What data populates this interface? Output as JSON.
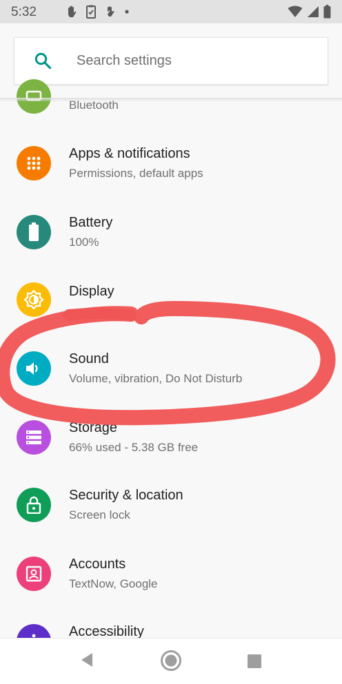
{
  "status_bar": {
    "time": "5:32",
    "left_icons": [
      "hand-icon",
      "clipboard-icon",
      "gesture-icon",
      "dot-icon"
    ],
    "right_icons": [
      "wifi-icon",
      "signal-icon",
      "battery-icon"
    ]
  },
  "search": {
    "placeholder": "Search settings",
    "accent": "#009688"
  },
  "settings_items": [
    {
      "id": "bluetooth",
      "title": "",
      "subtitle": "Bluetooth",
      "icon": "devices-icon",
      "color": "#7cb342"
    },
    {
      "id": "apps",
      "title": "Apps & notifications",
      "subtitle": "Permissions, default apps",
      "icon": "apps-grid-icon",
      "color": "#f57c00"
    },
    {
      "id": "battery",
      "title": "Battery",
      "subtitle": "100%",
      "icon": "battery-icon",
      "color": "#26897b"
    },
    {
      "id": "display",
      "title": "Display",
      "subtitle": "",
      "icon": "brightness-icon",
      "color": "#fbbc05"
    },
    {
      "id": "sound",
      "title": "Sound",
      "subtitle": "Volume, vibration, Do Not Disturb",
      "icon": "volume-icon",
      "color": "#00acc1"
    },
    {
      "id": "storage",
      "title": "Storage",
      "subtitle": "66% used - 5.38 GB free",
      "icon": "storage-icon",
      "color": "#b94fdf"
    },
    {
      "id": "security",
      "title": "Security & location",
      "subtitle": "Screen lock",
      "icon": "lock-icon",
      "color": "#0f9d58"
    },
    {
      "id": "accounts",
      "title": "Accounts",
      "subtitle": "TextNow, Google",
      "icon": "account-box-icon",
      "color": "#ec407a"
    },
    {
      "id": "accessibility",
      "title": "Accessibility",
      "subtitle": "",
      "icon": "accessibility-icon",
      "color": "#5e2fc8"
    }
  ],
  "annotation": {
    "color": "#f05555",
    "target": "sound"
  },
  "nav_bar": {
    "buttons": [
      "back-icon",
      "home-icon",
      "recents-icon"
    ]
  }
}
